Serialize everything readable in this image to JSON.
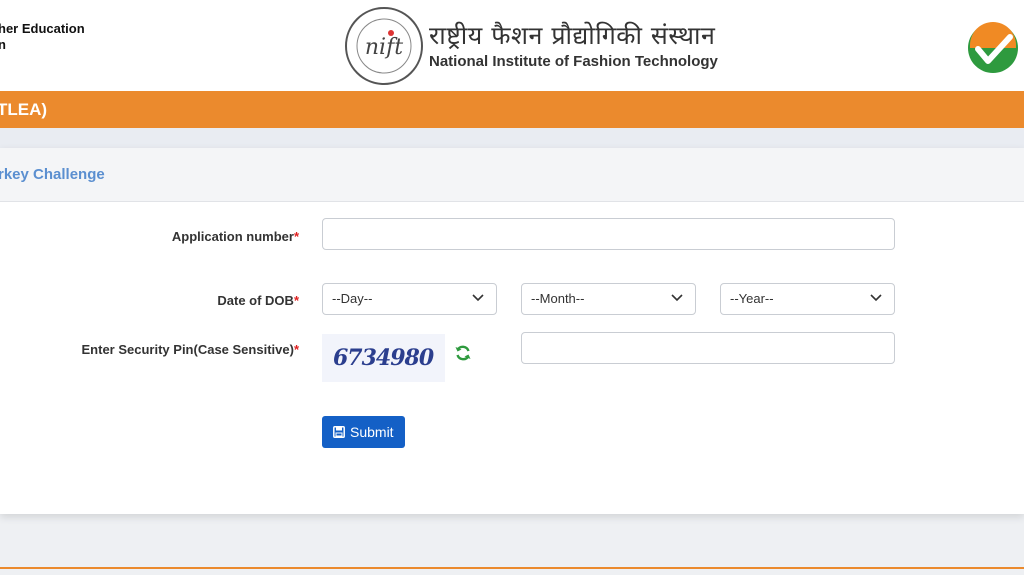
{
  "header": {
    "ministry_text": "her Education",
    "ministry_text_line2": "n",
    "logo_text": "nift",
    "logo_ring_text": "राष्ट्रीय फैशन प्रौद्योगिकी संस्थान · National Institute of Fashion Technology",
    "title_hindi": "राष्ट्रीय फैशन प्रौद्योगिकी संस्थान",
    "title_english": "National Institute of Fashion Technology",
    "nta_logo_icon": "nta-check-logo"
  },
  "banner": {
    "text": "TLEA)"
  },
  "card": {
    "heading": "rkey Challenge",
    "application_label": "Application number",
    "dob_label": "Date of DOB",
    "pin_label": "Enter Security Pin(Case Sensitive)",
    "required_mark": "*",
    "application_value": "",
    "day_select": "--Day--",
    "month_select": "--Month--",
    "year_select": "--Year--",
    "captcha_text": "6734980",
    "pin_value": "",
    "submit_label": "Submit"
  },
  "colors": {
    "accent_orange": "#eb8a2d",
    "primary_blue": "#1460c6",
    "heading_blue": "#5b8fd0",
    "required_red": "#e02020"
  }
}
